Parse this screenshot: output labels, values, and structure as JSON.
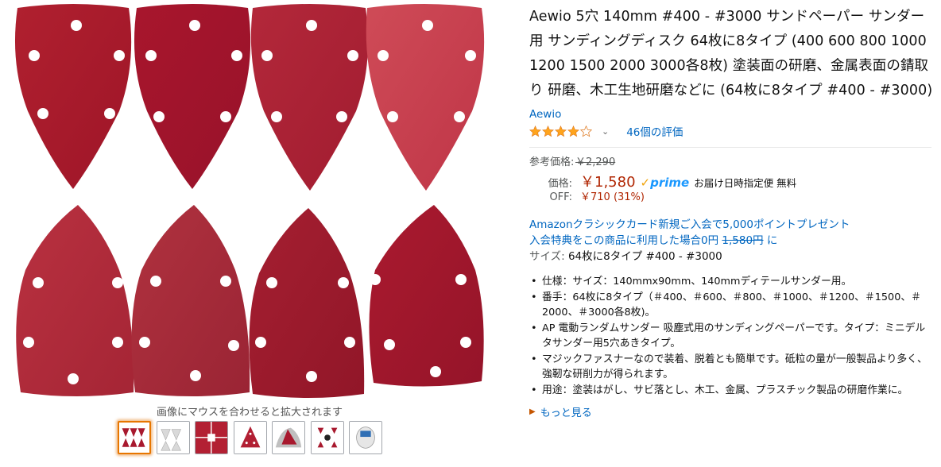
{
  "gallery": {
    "hover_hint": "画像にマウスを合わせると拡大されます",
    "colors": {
      "pad_dark": "#a5182f",
      "pad_mid": "#b92a3f",
      "pad_light": "#c9414f",
      "hole": "#ffffff"
    }
  },
  "product": {
    "title": "Aewio 5穴 140mm #400 - #3000 サンドペーパー サンダー用 サンディングディスク 64枚に8タイプ (400 600 800 1000 1200 1500 2000 3000各8枚) 塗装面の研磨、金属表面の錆取り 研磨、木工生地研磨などに (64枚に8タイプ #400 - #3000)",
    "brand": "Aewio",
    "rating": 4.0,
    "reviews": "46個の評価"
  },
  "price": {
    "list_label": "参考価格:",
    "list_price": "￥2,290",
    "price_label": "価格:",
    "price": "￥1,580",
    "prime_check": "✓",
    "prime_word": "prime",
    "shipping": "お届け日時指定便 無料",
    "off_label": "OFF:",
    "savings": "￥710 (31%)"
  },
  "promo": {
    "line1": "Amazonクラシックカード新規ご入会で5,000ポイントプレゼント",
    "line2_prefix": "入会特典をこの商品に利用した場合",
    "line2_new": "0円",
    "line2_old": "1,580円",
    "line2_suffix": " に"
  },
  "size": {
    "label": "サイズ:",
    "value": "64枚に8タイプ #400 - #3000"
  },
  "bullets": [
    "仕様：サイズ：140mmx90mm、140mmディテールサンダー用。",
    "番手：64枚に8タイプ（＃400、＃600、＃800、＃1000、＃1200、＃1500、＃2000、＃3000各8枚)。",
    "AP 電動ランダムサンダー 吸塵式用のサンディングペーパーです。タイプ：ミニデルタサンダー用5穴あきタイプ。",
    "マジックファスナーなので装着、脱着とも簡単です。砥粒の量が一般製品より多く、強靭な研削力が得られます。",
    "用途：塗装はがし、サビ落とし、木工、金属、プラスチック製品の研磨作業に。"
  ],
  "more": "もっと見る",
  "colors": {
    "link": "#0066c0",
    "price": "#b12704",
    "star": "#ffa41c",
    "prime": "#1a98ff"
  }
}
